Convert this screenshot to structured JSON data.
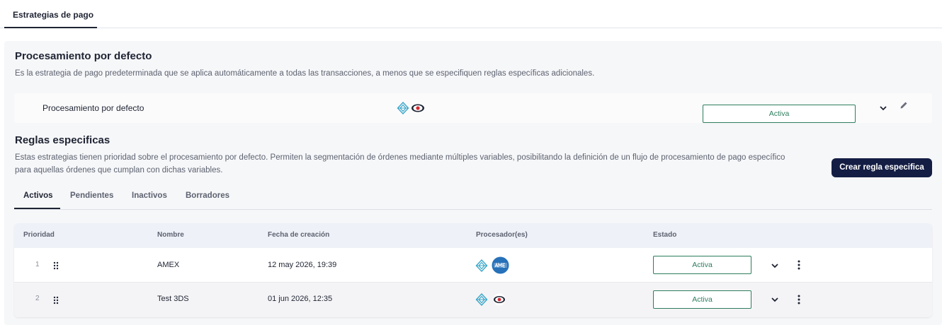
{
  "top_tabs": [
    {
      "label": "Estrategias de pago",
      "active": true
    }
  ],
  "default_section": {
    "title": "Procesamiento por defecto",
    "description": "Es la estrategia de pago predeterminada que se aplica automáticamente a todas las transacciones, a menos que se especifiquen reglas específicas adicionales.",
    "card": {
      "label": "Procesamiento por defecto",
      "processors": [
        "kushki-icon",
        "banorte-icon"
      ],
      "status": "Activa"
    }
  },
  "rules_section": {
    "title": "Reglas especificas",
    "description_line1": "Estas estrategias tienen prioridad sobre el procesamiento por defecto. Permiten la segmentación de órdenes mediante múltiples variables, posibilitando la definición de un flujo de procesamiento de pago específico",
    "description_line2": "para aquellas órdenes que cumplan con dichas variables.",
    "create_button": "Crear regla especifica",
    "tabs": [
      {
        "label": "Activos",
        "active": true
      },
      {
        "label": "Pendientes",
        "active": false
      },
      {
        "label": "Inactivos",
        "active": false
      },
      {
        "label": "Borradores",
        "active": false
      }
    ]
  },
  "table": {
    "headers": {
      "priority": "Prioridad",
      "name": "Nombre",
      "created": "Fecha de creación",
      "processors": "Procesador(es)",
      "status": "Estado"
    },
    "rows": [
      {
        "priority": "1",
        "name": "AMEX",
        "created": "12 may 2026, 19:39",
        "processors": [
          "kushki-icon",
          "amex-icon"
        ],
        "status": "Activa"
      },
      {
        "priority": "2",
        "name": "Test 3DS",
        "created": "01 jun 2026, 12:35",
        "processors": [
          "kushki-icon",
          "banorte-icon"
        ],
        "status": "Activa"
      }
    ]
  },
  "colors": {
    "primary_button": "#141e44",
    "status_green": "#2e7d5e",
    "kushki_blue": "#3aa6c9",
    "banorte_red": "#d7262e",
    "amex_blue": "#2671b9"
  }
}
